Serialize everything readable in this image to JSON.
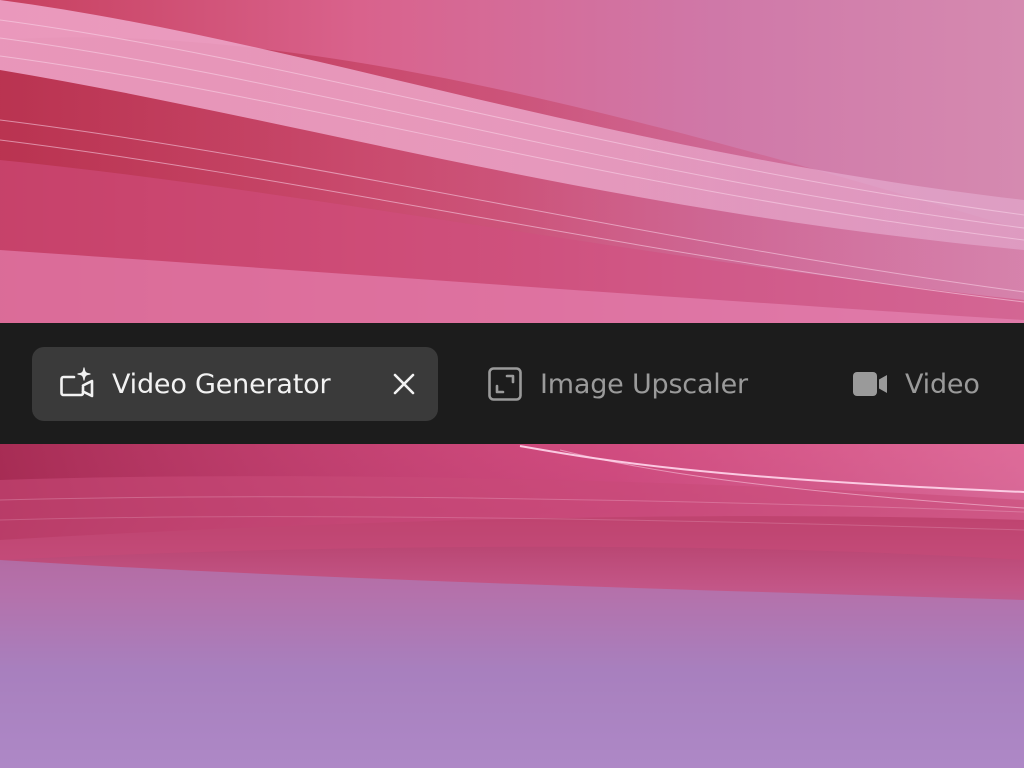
{
  "tabs": [
    {
      "label": "Video Generator",
      "active": true,
      "icon": "video-sparkle-icon",
      "closable": true,
      "close_icon": "close-icon"
    },
    {
      "label": "Image Upscaler",
      "active": false,
      "icon": "expand-icon"
    },
    {
      "label": "Video",
      "active": false,
      "icon": "video-camera-icon"
    }
  ],
  "colors": {
    "tabbar_background": "#1c1c1c",
    "active_tab_background": "#3a3a3a",
    "active_text": "#f2f2f2",
    "inactive_text": "#9a9a9a",
    "wallpaper_pink": "#e06a9e",
    "wallpaper_magenta": "#c9305f",
    "wallpaper_violet": "#a87fc0"
  }
}
